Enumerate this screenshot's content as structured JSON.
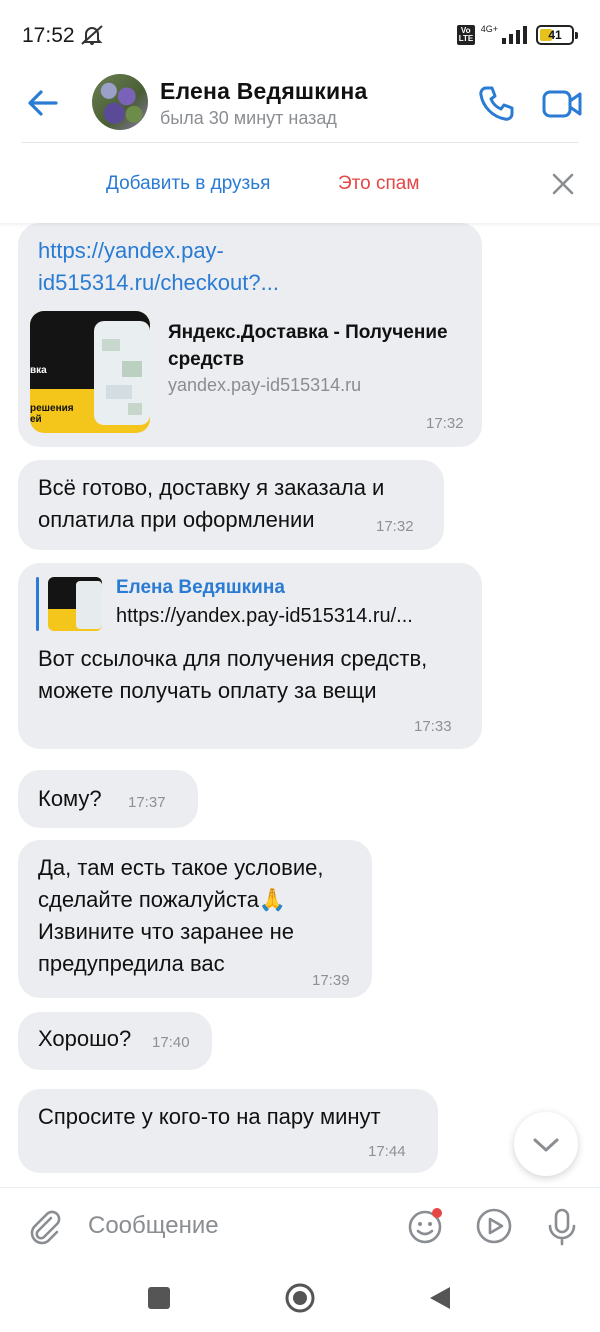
{
  "status_bar": {
    "time": "17:52",
    "network": "4G+",
    "volte": "Vo LTE",
    "battery": "41",
    "battery_level": 0.41,
    "battery_color": "#e5c21b"
  },
  "header": {
    "contact_name": "Елена Ведяшкина",
    "contact_status": "была 30 минут назад",
    "accent_color": "#2a7bd3"
  },
  "action_bar": {
    "add_friend_label": "Добавить в друзья",
    "spam_label": "Это спам",
    "spam_color": "#e64646"
  },
  "messages": [
    {
      "type": "link",
      "link_text": "https://yandex.pay-id515314.ru/checkout?...",
      "preview": {
        "title": "Яндекс.Доставка - Получение средств",
        "domain": "yandex.pay-id515314.ru",
        "thumb_text_top": "вка",
        "thumb_text_bottom": "решения\nей"
      },
      "time": "17:32"
    },
    {
      "type": "text",
      "text": "Всё готово, доставку я заказала и оплатила при оформлении",
      "time": "17:32"
    },
    {
      "type": "reply",
      "reply_author": "Елена Ведяшкина",
      "reply_snippet": "https://yandex.pay-id515314.ru/...",
      "text": "Вот ссылочка для получения средств, можете получать оплату за вещи",
      "time": "17:33"
    },
    {
      "type": "text",
      "text": "Кому?",
      "time": "17:37"
    },
    {
      "type": "text",
      "text": "Да, там есть такое условие, сделайте пожалуйста🙏 Извините что заранее не предупредила вас",
      "time": "17:39"
    },
    {
      "type": "text",
      "text": "Хорошо?",
      "time": "17:40"
    },
    {
      "type": "text",
      "text": "Спросите у кого-то на пару минут",
      "time": "17:44"
    }
  ],
  "composer": {
    "placeholder": "Сообщение"
  },
  "icons": {
    "back": "arrow-left-icon",
    "call": "phone-icon",
    "video": "video-camera-icon",
    "close": "close-icon",
    "attach": "paperclip-icon",
    "emoji": "smiley-icon",
    "voice_message": "play-circle-icon",
    "mic": "microphone-icon",
    "scroll": "chevron-down-icon"
  }
}
